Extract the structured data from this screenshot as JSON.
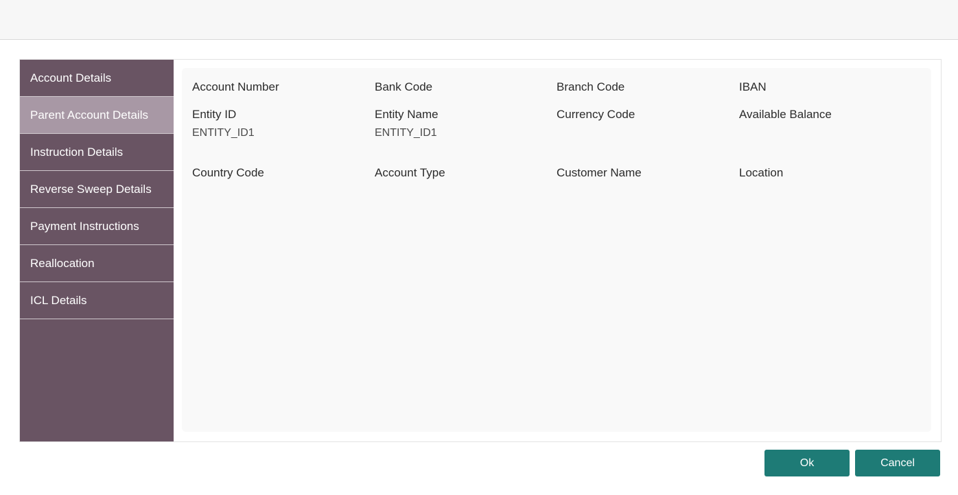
{
  "sidebar": {
    "items": [
      {
        "label": "Account Details",
        "active": false
      },
      {
        "label": "Parent Account Details",
        "active": true
      },
      {
        "label": "Instruction Details",
        "active": false
      },
      {
        "label": "Reverse Sweep Details",
        "active": false
      },
      {
        "label": "Payment Instructions",
        "active": false
      },
      {
        "label": "Reallocation",
        "active": false
      },
      {
        "label": "ICL Details",
        "active": false
      }
    ]
  },
  "fields": {
    "account_number": {
      "label": "Account Number",
      "value": ""
    },
    "bank_code": {
      "label": "Bank Code",
      "value": ""
    },
    "branch_code": {
      "label": "Branch Code",
      "value": ""
    },
    "iban": {
      "label": "IBAN",
      "value": ""
    },
    "entity_id": {
      "label": "Entity ID",
      "value": "ENTITY_ID1"
    },
    "entity_name": {
      "label": "Entity Name",
      "value": "ENTITY_ID1"
    },
    "currency_code": {
      "label": "Currency Code",
      "value": ""
    },
    "available_balance": {
      "label": "Available Balance",
      "value": ""
    },
    "country_code": {
      "label": "Country Code",
      "value": ""
    },
    "account_type": {
      "label": "Account Type",
      "value": ""
    },
    "customer_name": {
      "label": "Customer Name",
      "value": ""
    },
    "location": {
      "label": "Location",
      "value": ""
    }
  },
  "footer": {
    "ok_label": "Ok",
    "cancel_label": "Cancel"
  },
  "colors": {
    "sidebar_bg": "#695463",
    "sidebar_active": "#a898a5",
    "button_bg": "#1e7b76"
  }
}
